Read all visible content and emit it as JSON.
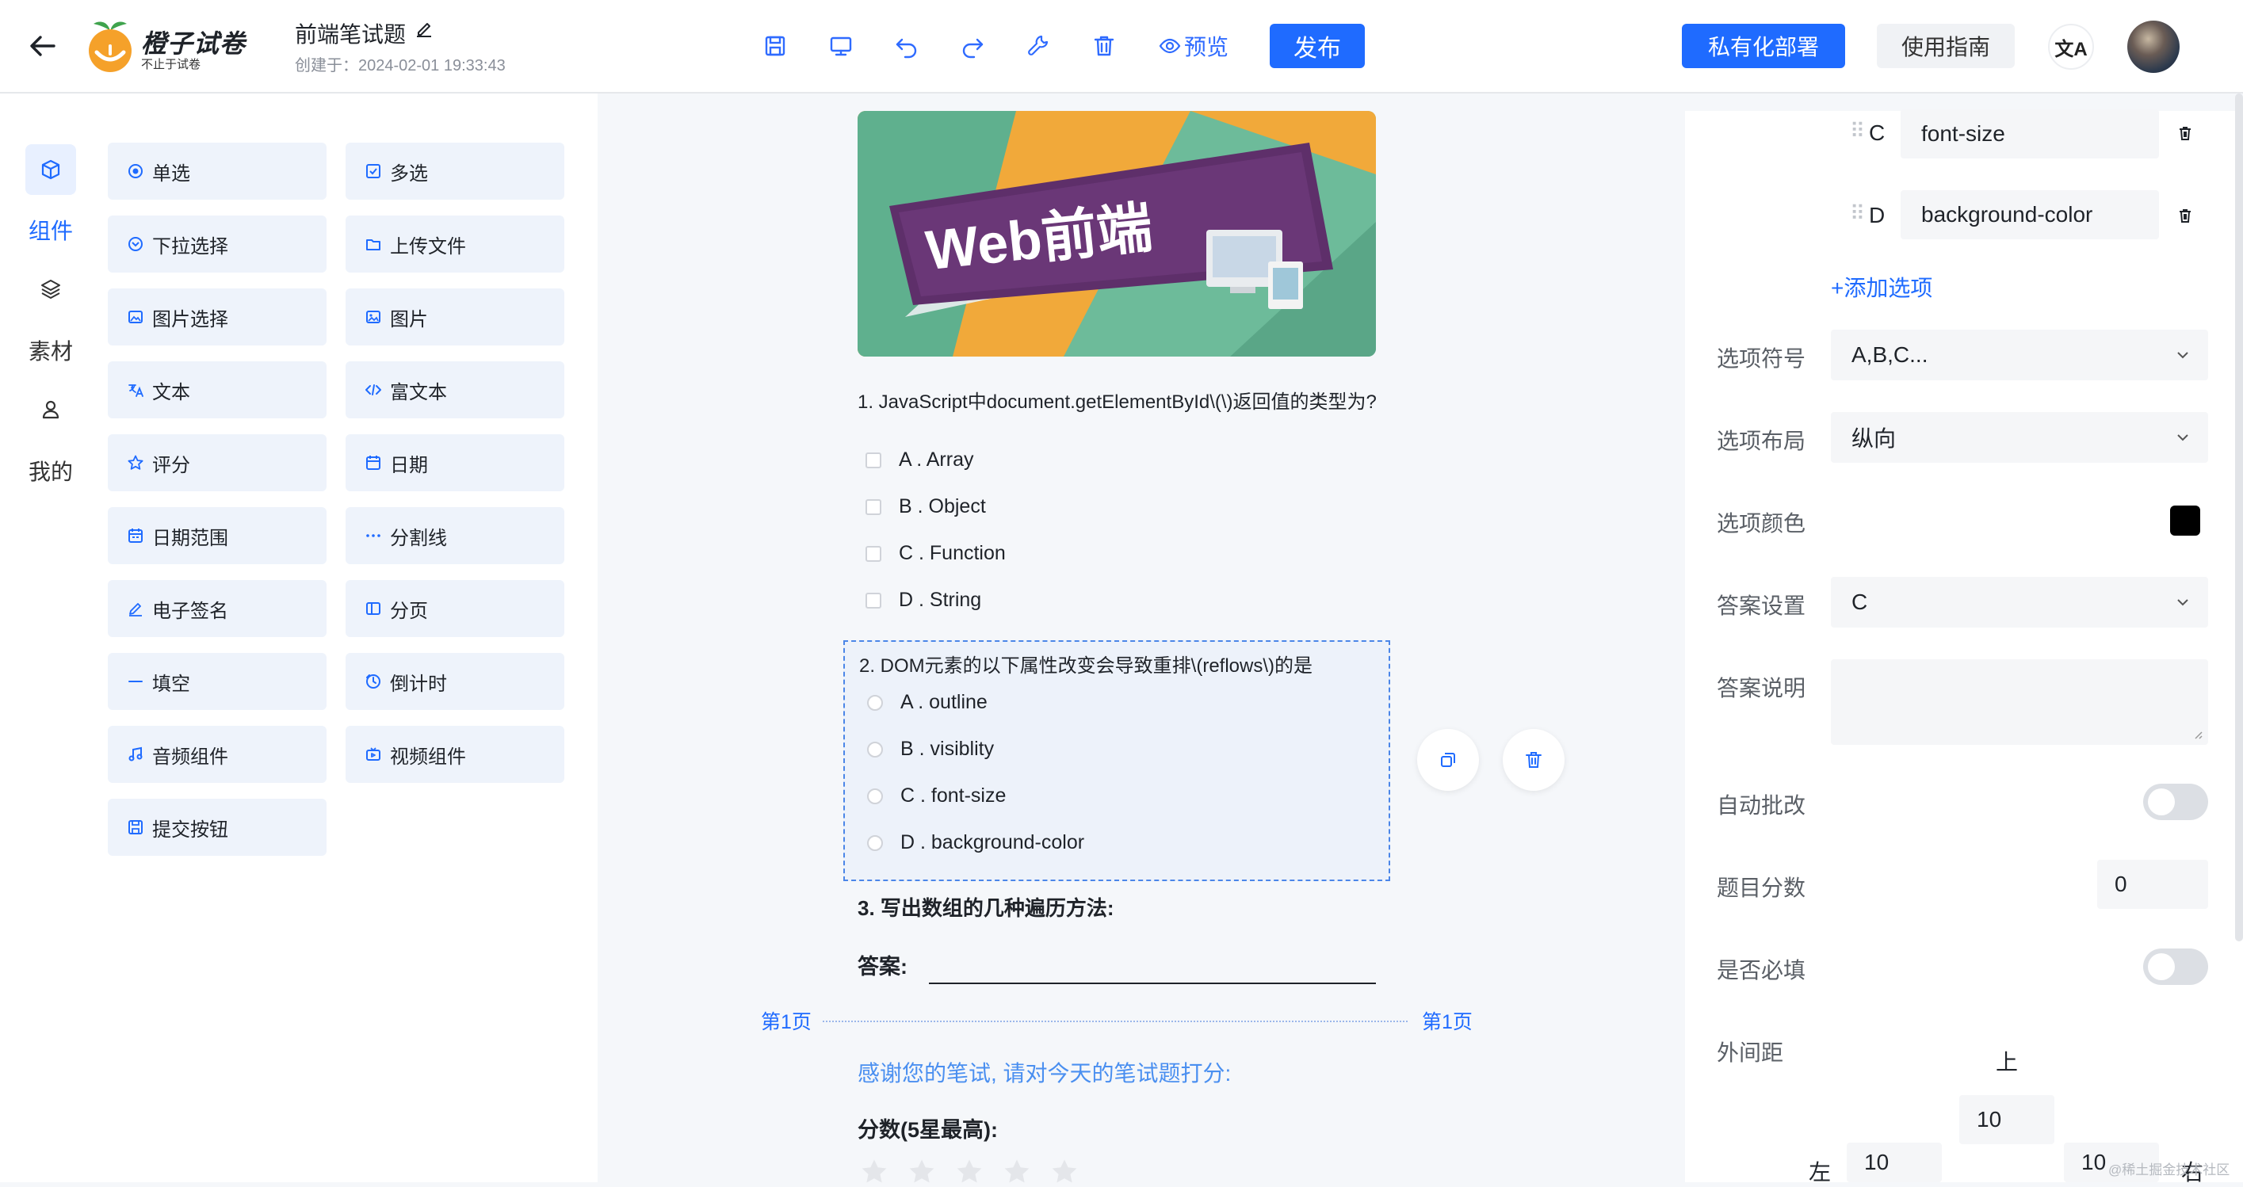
{
  "header": {
    "logo_name": "橙子试卷",
    "logo_slogan": "不止于试卷",
    "doc_title": "前端笔试题",
    "created": "创建于：2024-02-01 19:33:43",
    "preview_label": "预览",
    "publish_label": "发布",
    "private_deploy_label": "私有化部署",
    "guide_label": "使用指南",
    "lang_icon_text": "文A"
  },
  "rail": {
    "items": [
      {
        "label": "组件",
        "icon": "cube-icon",
        "active": true
      },
      {
        "label": "素材",
        "icon": "layers-icon",
        "active": false
      },
      {
        "label": "我的",
        "icon": "user-icon",
        "active": false
      }
    ]
  },
  "palette": {
    "items": [
      {
        "label": "单选",
        "icon": "radio-icon"
      },
      {
        "label": "多选",
        "icon": "checkbox-icon"
      },
      {
        "label": "下拉选择",
        "icon": "dropdown-icon"
      },
      {
        "label": "上传文件",
        "icon": "folder-icon"
      },
      {
        "label": "图片选择",
        "icon": "image-select-icon"
      },
      {
        "label": "图片",
        "icon": "image-icon"
      },
      {
        "label": "文本",
        "icon": "text-icon"
      },
      {
        "label": "富文本",
        "icon": "code-icon"
      },
      {
        "label": "评分",
        "icon": "star-icon"
      },
      {
        "label": "日期",
        "icon": "calendar-icon"
      },
      {
        "label": "日期范围",
        "icon": "date-range-icon"
      },
      {
        "label": "分割线",
        "icon": "divider-icon"
      },
      {
        "label": "电子签名",
        "icon": "pen-icon"
      },
      {
        "label": "分页",
        "icon": "pages-icon"
      },
      {
        "label": "填空",
        "icon": "blank-icon"
      },
      {
        "label": "倒计时",
        "icon": "timer-icon"
      },
      {
        "label": "音频组件",
        "icon": "music-icon"
      },
      {
        "label": "视频组件",
        "icon": "video-icon"
      },
      {
        "label": "提交按钮",
        "icon": "save-icon"
      }
    ]
  },
  "banner": {
    "text": "Web前端"
  },
  "questions": {
    "q1": {
      "text": "1. JavaScript中document.getElementById\\(\\)返回值的类型为?",
      "options": [
        "A . Array",
        "B . Object",
        "C . Function",
        "D . String"
      ]
    },
    "q2": {
      "text": "2. DOM元素的以下属性改变会导致重排\\(reflows\\)的是",
      "options": [
        "A . outline",
        "B . visiblity",
        "C . font-size",
        "D . background-color"
      ]
    },
    "q3": {
      "text": "3. 写出数组的几种遍历方法:",
      "answer_label": "答案:"
    }
  },
  "page_break": {
    "left": "第1页",
    "right": "第1页"
  },
  "rating": {
    "thanks": "感谢您的笔试, 请对今天的笔试题打分:",
    "score_label": "分数(5星最高):",
    "stars": 5
  },
  "properties": {
    "option_rows": [
      {
        "key": "C",
        "value": "font-size"
      },
      {
        "key": "D",
        "value": "background-color"
      }
    ],
    "add_option": "+添加选项",
    "option_symbol": {
      "label": "选项符号",
      "value": "A,B,C..."
    },
    "option_layout": {
      "label": "选项布局",
      "value": "纵向"
    },
    "option_color": {
      "label": "选项颜色",
      "value": "#000000"
    },
    "answer_setting": {
      "label": "答案设置",
      "value": "C"
    },
    "answer_desc": {
      "label": "答案说明",
      "value": ""
    },
    "auto_grade": {
      "label": "自动批改",
      "on": false
    },
    "score": {
      "label": "题目分数",
      "value": "0"
    },
    "required": {
      "label": "是否必填",
      "on": false
    },
    "margin": {
      "label": "外间距",
      "top_label": "上",
      "top": "10",
      "left_label": "左",
      "left": "10",
      "right_label": "右",
      "right": "10"
    }
  },
  "watermark": "@稀土掘金技术社区",
  "colors": {
    "accent": "#1f6bff",
    "link": "#4a8ff0"
  }
}
